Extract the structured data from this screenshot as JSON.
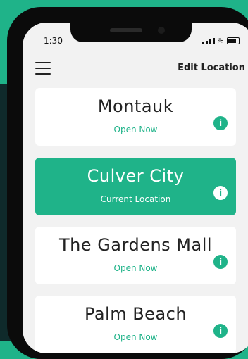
{
  "status_bar": {
    "time": "1:30"
  },
  "header": {
    "edit_location_label": "Edit Location"
  },
  "locations": [
    {
      "name": "Montauk",
      "status": "Open Now",
      "current": false
    },
    {
      "name": "Culver City",
      "status": "Current Location",
      "current": true
    },
    {
      "name": "The Gardens Mall",
      "status": "Open Now",
      "current": false
    },
    {
      "name": "Palm Beach",
      "status": "Open Now",
      "current": false
    }
  ],
  "icons": {
    "menu": "hamburger-menu-icon",
    "info": "info-icon",
    "signal": "signal-icon",
    "wifi": "wifi-icon",
    "battery": "battery-icon"
  },
  "colors": {
    "accent": "#1fb389",
    "background": "#f2f2f2",
    "card": "#ffffff"
  }
}
